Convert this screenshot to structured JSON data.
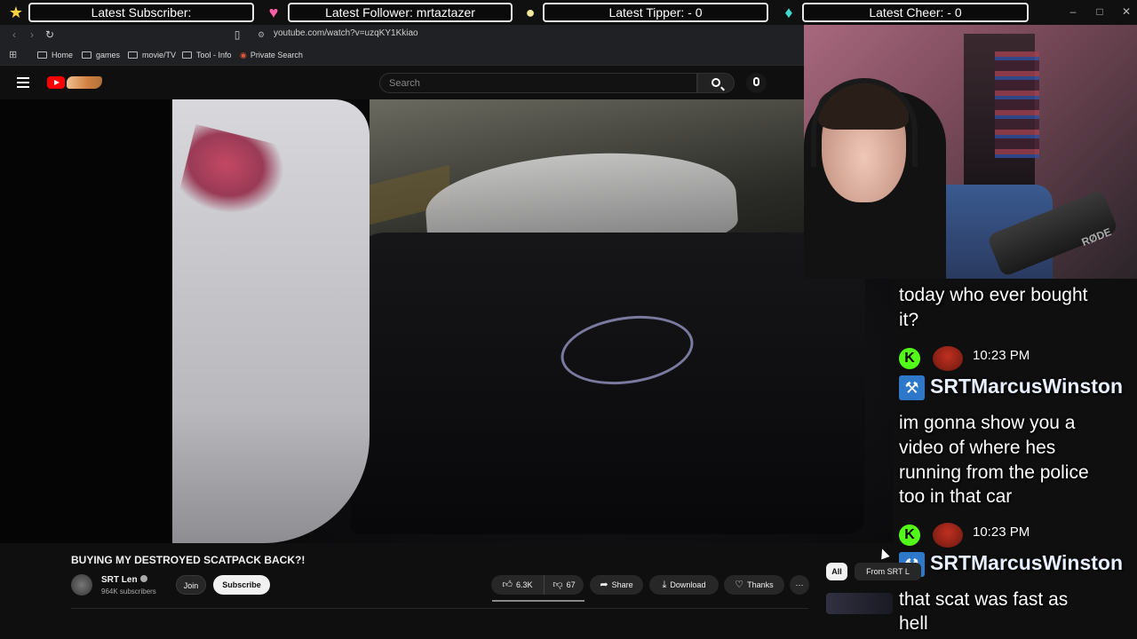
{
  "overlay": {
    "subscriber": "Latest Subscriber:",
    "follower": "Latest Follower: mrtaztazer",
    "tipper": "Latest Tipper:  - 0",
    "cheer": "Latest Cheer:  - 0"
  },
  "browser": {
    "url": "youtube.com/watch?v=uzqKY1Kkiao",
    "bookmarks": [
      "Home",
      "games",
      "movie/TV",
      "Tool - Info",
      "Private Search"
    ]
  },
  "youtube": {
    "search_placeholder": "Search"
  },
  "video": {
    "title": "BUYING MY DESTROYED SCATPACK BACK?!",
    "channel": "SRT Len",
    "subscribers": "964K subscribers",
    "join": "Join",
    "subscribe": "Subscribe",
    "likes": "6.3K",
    "dislikes": "67",
    "share": "Share",
    "download": "Download",
    "thanks": "Thanks",
    "more": "⋯"
  },
  "sidebar": {
    "chips": [
      "All",
      "From SRT L"
    ]
  },
  "webcam": {
    "mic_label": "RØDE"
  },
  "chat": {
    "messages": [
      {
        "lines": [
          "today who ever bought",
          "it?"
        ]
      },
      {
        "time": "10:23 PM",
        "user": "SRTMarcusWinston",
        "lines": [
          "im gonna show you a",
          "video of where hes",
          "running from the police",
          "too in that car"
        ]
      },
      {
        "time": "10:23 PM",
        "user": "SRTMarcusWinston",
        "lines": [
          "that scat was fast as",
          "hell"
        ]
      }
    ]
  }
}
